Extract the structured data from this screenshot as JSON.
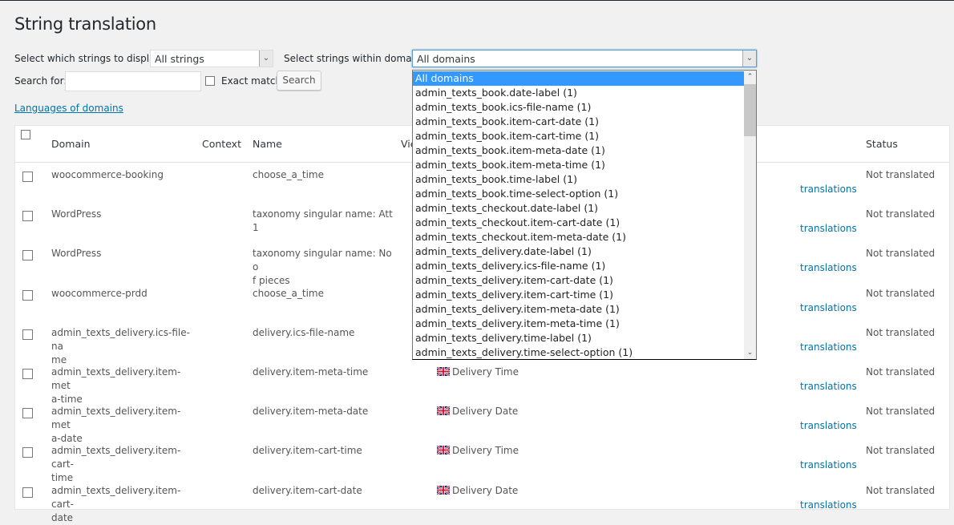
{
  "page": {
    "title": "String translation"
  },
  "filters": {
    "display_label": "Select which strings to display:",
    "display_value": "All strings",
    "domain_label": "Select strings within domain:",
    "domain_value": "All domains",
    "search_label": "Search for:",
    "search_value": "",
    "exact_match_label": "Exact match",
    "exact_match_checked": false,
    "search_button": "Search",
    "languages_link": "Languages of domains"
  },
  "domain_dropdown": {
    "selected_index": 0,
    "options": [
      "All domains",
      "admin_texts_book.date-label (1)",
      "admin_texts_book.ics-file-name (1)",
      "admin_texts_book.item-cart-date (1)",
      "admin_texts_book.item-cart-time (1)",
      "admin_texts_book.item-meta-date (1)",
      "admin_texts_book.item-meta-time (1)",
      "admin_texts_book.time-label (1)",
      "admin_texts_book.time-select-option (1)",
      "admin_texts_checkout.date-label (1)",
      "admin_texts_checkout.item-cart-date (1)",
      "admin_texts_checkout.item-meta-date (1)",
      "admin_texts_delivery.date-label (1)",
      "admin_texts_delivery.ics-file-name (1)",
      "admin_texts_delivery.item-cart-date (1)",
      "admin_texts_delivery.item-cart-time (1)",
      "admin_texts_delivery.item-meta-date (1)",
      "admin_texts_delivery.item-meta-time (1)",
      "admin_texts_delivery.time-label (1)",
      "admin_texts_delivery.time-select-option (1)"
    ]
  },
  "table": {
    "headers": {
      "domain": "Domain",
      "context": "Context",
      "name": "Name",
      "view": "Vie",
      "status": "Status"
    },
    "rows": [
      {
        "domain": [
          "woocommerce-booking"
        ],
        "context": "",
        "name": [
          "choose_a_time"
        ],
        "value": "",
        "translations": "translations",
        "status": "Not translated"
      },
      {
        "domain": [
          "WordPress"
        ],
        "context": "",
        "name": [
          "taxonomy singular name: Att 1"
        ],
        "value": "",
        "translations": "translations",
        "status": "Not translated"
      },
      {
        "domain": [
          "WordPress"
        ],
        "context": "",
        "name": [
          "taxonomy singular name: No o",
          "f pieces"
        ],
        "value": "",
        "translations": "translations",
        "status": "Not translated"
      },
      {
        "domain": [
          "woocommerce-prdd"
        ],
        "context": "",
        "name": [
          "choose_a_time"
        ],
        "value": "",
        "translations": "translations",
        "status": "Not translated"
      },
      {
        "domain": [
          "admin_texts_delivery.ics-file-na",
          "me"
        ],
        "context": "",
        "name": [
          "delivery.ics-file-name"
        ],
        "value": "",
        "translations": "translations",
        "status": "Not translated"
      },
      {
        "domain": [
          "admin_texts_delivery.item-met",
          "a-time"
        ],
        "context": "",
        "name": [
          "delivery.item-meta-time"
        ],
        "value": "Delivery Time",
        "translations": "translations",
        "status": "Not translated"
      },
      {
        "domain": [
          "admin_texts_delivery.item-met",
          "a-date"
        ],
        "context": "",
        "name": [
          "delivery.item-meta-date"
        ],
        "value": "Delivery Date",
        "translations": "translations",
        "status": "Not translated"
      },
      {
        "domain": [
          "admin_texts_delivery.item-cart-",
          "time"
        ],
        "context": "",
        "name": [
          "delivery.item-cart-time"
        ],
        "value": "Delivery Time",
        "translations": "translations",
        "status": "Not translated"
      },
      {
        "domain": [
          "admin_texts_delivery.item-cart-",
          "date"
        ],
        "context": "",
        "name": [
          "delivery.item-cart-date"
        ],
        "value": "Delivery Date",
        "translations": "translations",
        "status": "Not translated"
      }
    ]
  },
  "icons": {
    "flag": "uk-flag-icon",
    "dropdown_arrow": "chevron-down-icon"
  },
  "colors": {
    "link": "#0073aa",
    "selected_option": "#3399ff",
    "background": "#f1f1f1"
  }
}
